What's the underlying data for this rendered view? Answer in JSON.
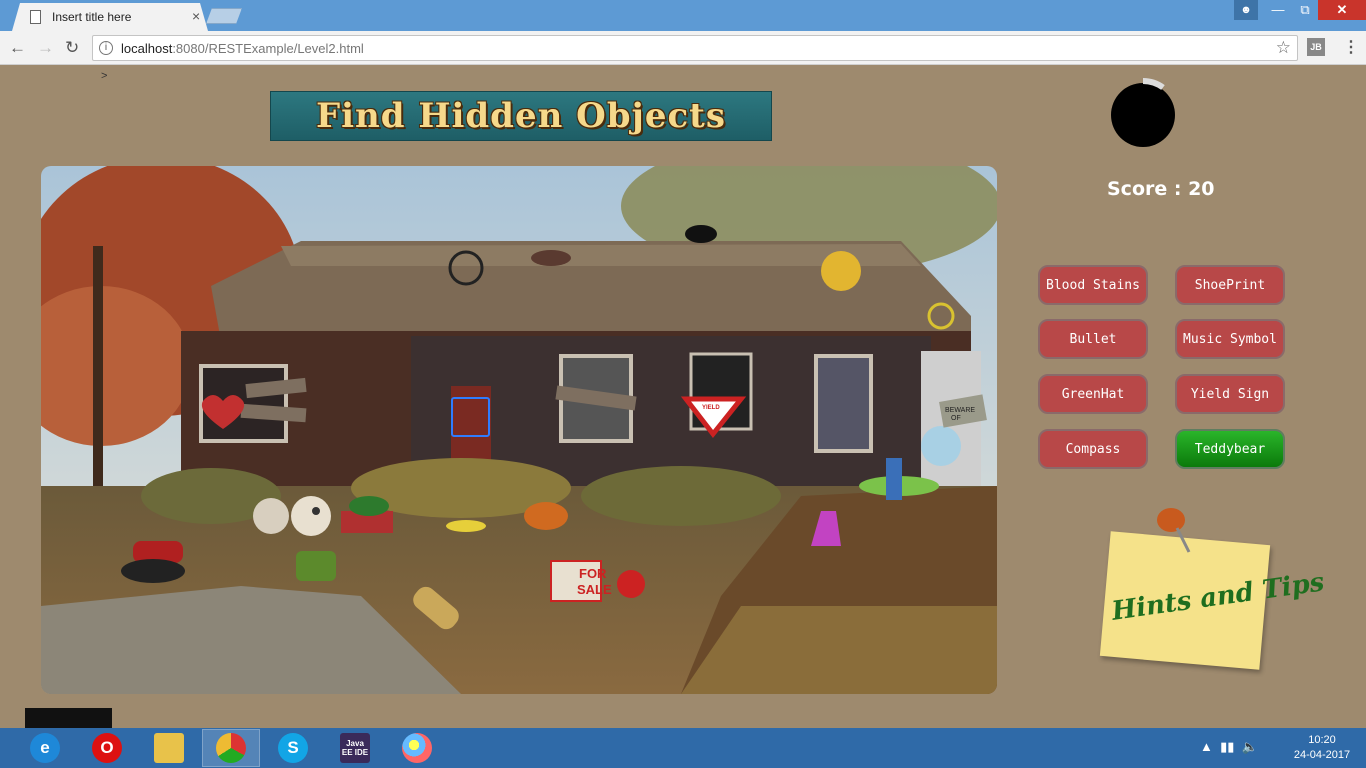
{
  "browser": {
    "tab_title": "Insert title here",
    "tab_close": "×",
    "url_host": "localhost",
    "url_rest": ":8080/RESTExample/Level2.html",
    "ext_label": "JB"
  },
  "page": {
    "breadcrumb_text": ">",
    "banner_title": "Find Hidden Objects",
    "score_label": "Score : 20",
    "timer_progress": 0.1,
    "hints_label": "Hints and Tips",
    "sign_labels": {
      "for_sale": [
        "FOR",
        "SALE"
      ],
      "yield": "YIELD",
      "beware": [
        "BEWARE",
        "OF"
      ]
    }
  },
  "objects": [
    {
      "label": "Blood Stains",
      "found": false
    },
    {
      "label": "ShoePrint",
      "found": false
    },
    {
      "label": "Bullet",
      "found": false
    },
    {
      "label": "Music Symbol",
      "found": false
    },
    {
      "label": "GreenHat",
      "found": false
    },
    {
      "label": "Yield Sign",
      "found": false
    },
    {
      "label": "Compass",
      "found": false
    },
    {
      "label": "Teddybear",
      "found": true
    }
  ],
  "colors": {
    "page_bg": "#9e8a6e",
    "object_button": "#b84848",
    "object_button_found": "#1a9a1a",
    "banner_text": "#f6d98b",
    "titlebar": "#5d9ad4"
  },
  "taskbar": {
    "apps": [
      "internet-explorer-icon",
      "opera-icon",
      "file-explorer-icon",
      "chrome-icon",
      "skype-icon",
      "java-ee-ide-icon",
      "paint-icon"
    ],
    "ide_label": "Java EE IDE",
    "time": "10:20",
    "date": "24-04-2017"
  }
}
